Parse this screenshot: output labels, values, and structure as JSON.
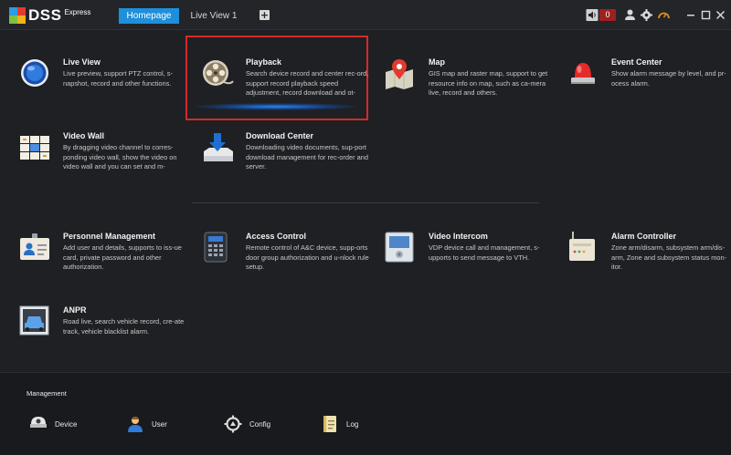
{
  "app": {
    "logo_text": "DSS",
    "logo_sub": "Express"
  },
  "tabs": [
    {
      "label": "Homepage",
      "active": true
    },
    {
      "label": "Live View 1",
      "active": false
    }
  ],
  "add_tab_label": "+",
  "header": {
    "alarm_count": "0",
    "icons": [
      "speaker-icon",
      "user-icon",
      "gear-icon",
      "gauge-icon",
      "minimize-icon",
      "maximize-icon",
      "close-icon"
    ]
  },
  "modules": [
    {
      "title": "Live View",
      "desc": "Live preview, support PTZ control, s-napshot, record and other functions.",
      "icon": "live-view-icon"
    },
    {
      "title": "Playback",
      "desc": "Search device record and center rec-ord, support record playback speed adjustment, record download and ot-",
      "icon": "film-reel-icon"
    },
    {
      "title": "Map",
      "desc": "GIS map and raster map, support to get resource info on map, such as ca-mera live, record and others.",
      "icon": "map-pin-icon"
    },
    {
      "title": "Event Center",
      "desc": "Show alarm message by level, and pr-ocess alarm.",
      "icon": "alarm-light-icon"
    },
    {
      "title": "Video Wall",
      "desc": "By dragging video channel to corres-ponding video wall, show the video on video wall and you can set and m-",
      "icon": "video-wall-icon"
    },
    {
      "title": "Download Center",
      "desc": "Downloading video documents, sup-port download management for rec-order and server.",
      "icon": "download-icon"
    },
    {
      "title": "Personnel Management",
      "desc": "Add user and details, supports to iss-ue card, private password and other authorization.",
      "icon": "id-card-icon"
    },
    {
      "title": "Access Control",
      "desc": "Remote control of A&C device, supp-orts door group authorization and u-nlock rule setup.",
      "icon": "access-keypad-icon"
    },
    {
      "title": "Video Intercom",
      "desc": "VDP device call and management, s-upports to send message to VTH.",
      "icon": "intercom-icon"
    },
    {
      "title": "Alarm Controller",
      "desc": "Zone arm/disarm, subsystem arm/dis-arm, Zone and subsystem status mon-itor.",
      "icon": "alarm-controller-icon"
    },
    {
      "title": "ANPR",
      "desc": "Road live, search vehicle record, cre-ate track, vehicle blacklist alarm.",
      "icon": "car-plate-icon"
    }
  ],
  "management": {
    "title": "Management",
    "items": [
      {
        "label": "Device",
        "icon": "camera-dome-icon"
      },
      {
        "label": "User",
        "icon": "user-icon"
      },
      {
        "label": "Config",
        "icon": "gear-icon"
      },
      {
        "label": "Log",
        "icon": "notebook-icon"
      }
    ]
  },
  "colors": {
    "background": "#1e2024",
    "accent": "#1e8fdb",
    "highlight": "#d42a2a"
  }
}
